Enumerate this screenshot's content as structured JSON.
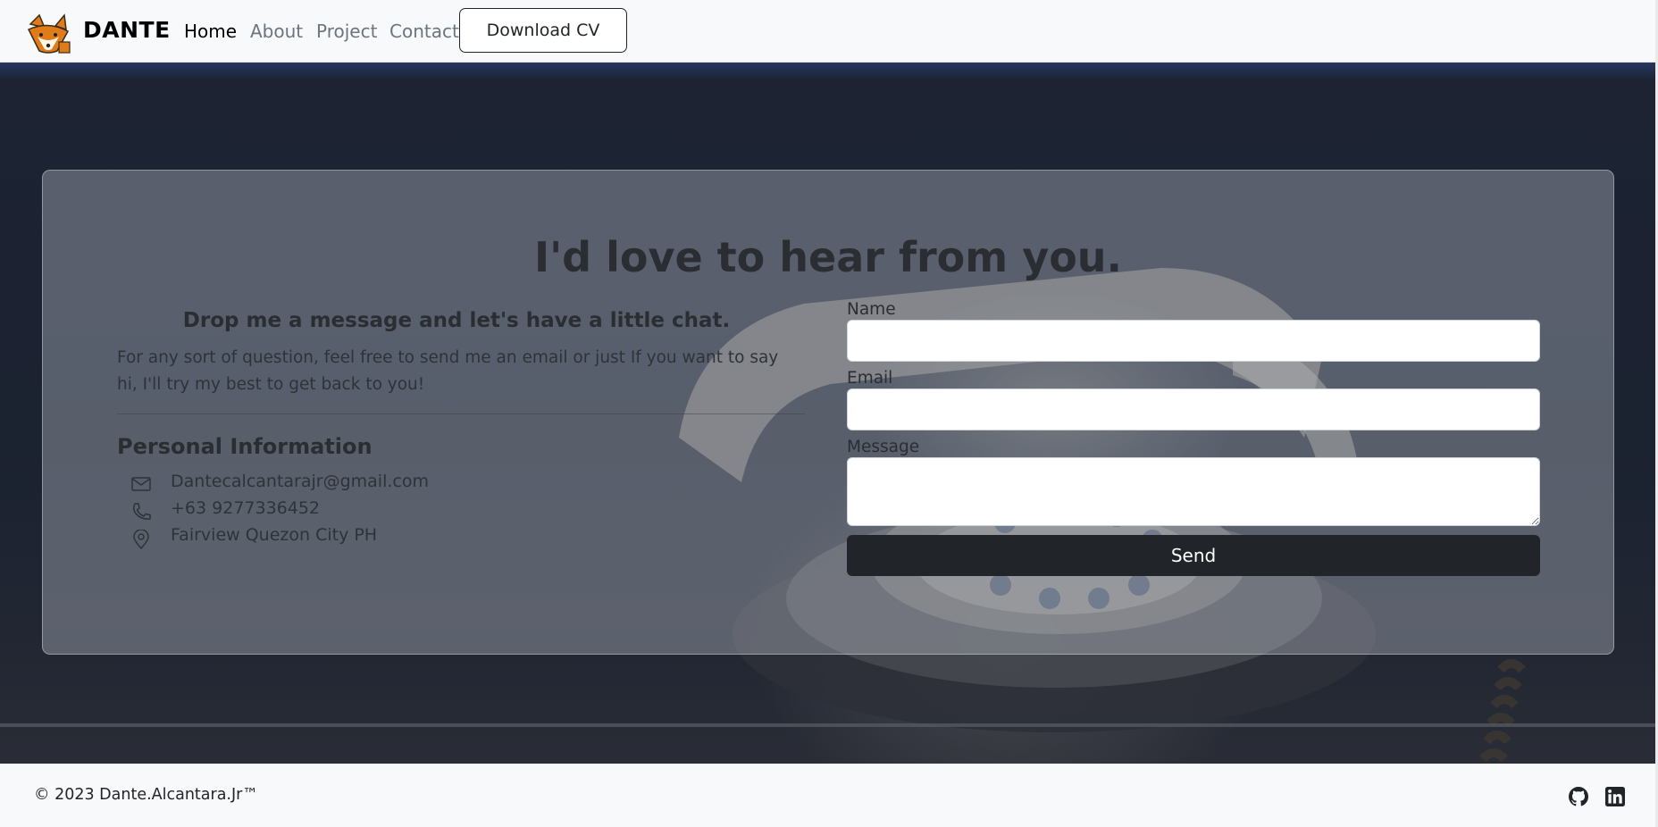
{
  "nav": {
    "brand": "DANTE",
    "links": [
      {
        "label": "Home",
        "active": true
      },
      {
        "label": "About",
        "active": false
      },
      {
        "label": "Project",
        "active": false
      },
      {
        "label": "Contact",
        "active": false
      }
    ],
    "cv_button": "Download CV"
  },
  "contact": {
    "headline": "I'd love to hear from you.",
    "subheading": "Drop me a message and let's have a little chat.",
    "intro": "For any sort of question, feel free to send me an email or just If you want to say hi, I'll try my best to get back to you!",
    "info_title": "Personal Information",
    "email": "Dantecalcantarajr@gmail.com",
    "phone": "+63 9277336452",
    "location": "Fairview Quezon City PH",
    "form": {
      "name_label": "Name",
      "name_value": "",
      "email_label": "Email",
      "email_value": "",
      "message_label": "Message",
      "message_value": "",
      "send_label": "Send"
    }
  },
  "footer": {
    "copyright": "© 2023 Dante.Alcantara.Jr™"
  },
  "icons": [
    "fox-logo-icon",
    "envelope-icon",
    "phone-icon",
    "location-pin-icon",
    "github-icon",
    "linkedin-icon"
  ],
  "colors": {
    "accent": "#212529",
    "nav_bg": "#f8f9fa",
    "fox_orange": "#e07b1a"
  }
}
